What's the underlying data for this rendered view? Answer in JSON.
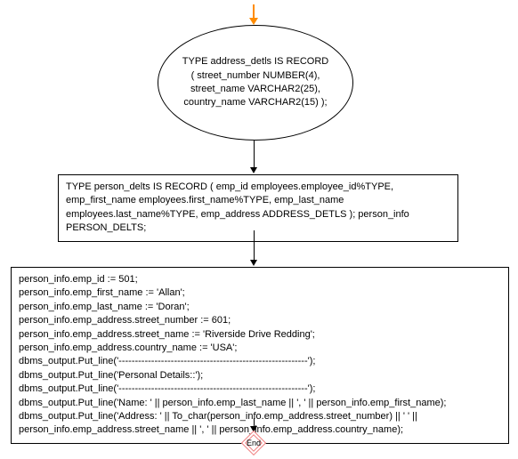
{
  "flowchart": {
    "ellipse_text": "TYPE address_detls IS RECORD ( street_number NUMBER(4), street_name VARCHAR2(25), country_name VARCHAR2(15) );",
    "record_def": "TYPE person_delts IS RECORD ( emp_id employees.employee_id%TYPE, emp_first_name employees.first_name%TYPE, emp_last_name employees.last_name%TYPE, emp_address ADDRESS_DETLS ); person_info PERSON_DELTS;",
    "assignments": [
      "person_info.emp_id := 501;",
      "person_info.emp_first_name := 'Allan';",
      "person_info.emp_last_name := 'Doran';",
      "person_info.emp_address.street_number := 601;",
      "person_info.emp_address.street_name := 'Riverside Drive Redding';",
      "person_info.emp_address.country_name := 'USA';",
      "dbms_output.Put_line('----------------------------------------------------------');",
      "dbms_output.Put_line('Personal Details::');",
      "dbms_output.Put_line('----------------------------------------------------------');",
      "dbms_output.Put_line('Name: ' || person_info.emp_last_name || ', ' || person_info.emp_first_name);",
      "dbms_output.Put_line('Address: ' || To_char(person_info.emp_address.street_number) || '  ' || person_info.emp_address.street_name || ', ' || person_info.emp_address.country_name);"
    ],
    "end_label": "End"
  }
}
